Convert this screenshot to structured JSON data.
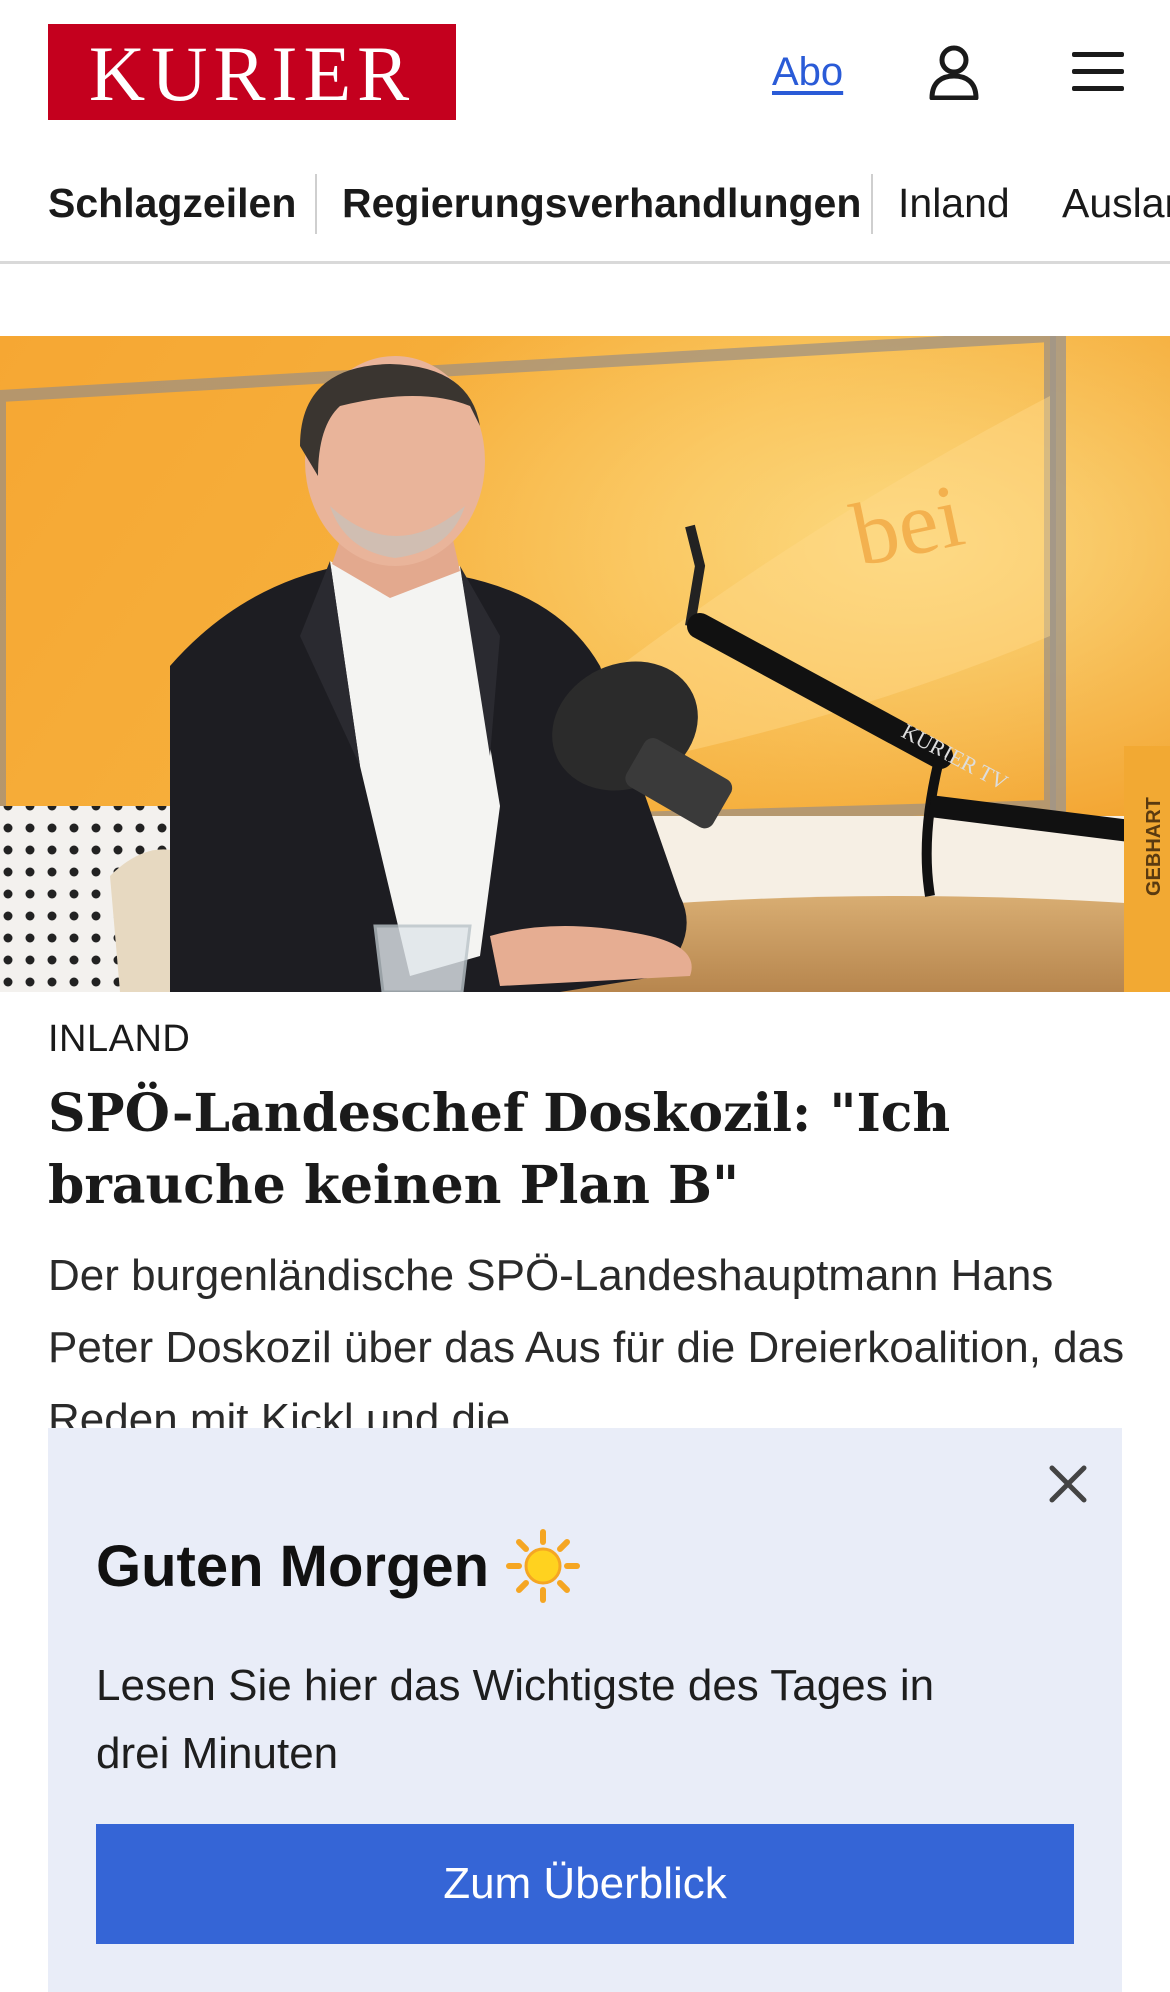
{
  "header": {
    "logo_text": "KURIER",
    "abo_label": "Abo",
    "user_icon": "user-icon",
    "menu_icon": "hamburger-menu-icon",
    "brand_color": "#c4001e",
    "link_color": "#2a5bd7"
  },
  "nav": {
    "items": [
      {
        "label": "Schlagzeilen"
      },
      {
        "label": "Regierungsverhandlungen"
      },
      {
        "label": "Inland"
      },
      {
        "label": "Ausland"
      }
    ]
  },
  "article": {
    "category": "INLAND",
    "headline": "SPÖ-Landeschef Doskozil: \"Ich brauche keinen Plan B\"",
    "teaser": "Der burgenländische SPÖ-Landeshauptmann Hans Peter Doskozil über das Aus für die Dreierkoalition, das Reden mit Kickl und die"
  },
  "hero": {
    "mic_brand": "KURIER TV",
    "backdrop_text": "bei",
    "book_text": "GEBHART"
  },
  "overlay": {
    "title": "Guten Morgen",
    "title_icon": "sun-icon",
    "text": "Lesen Sie hier das Wichtigste des Tages in drei Minuten",
    "button_label": "Zum Überblick",
    "close_icon": "close-icon",
    "background_color": "#e9edf8",
    "button_color": "#3565d6"
  }
}
